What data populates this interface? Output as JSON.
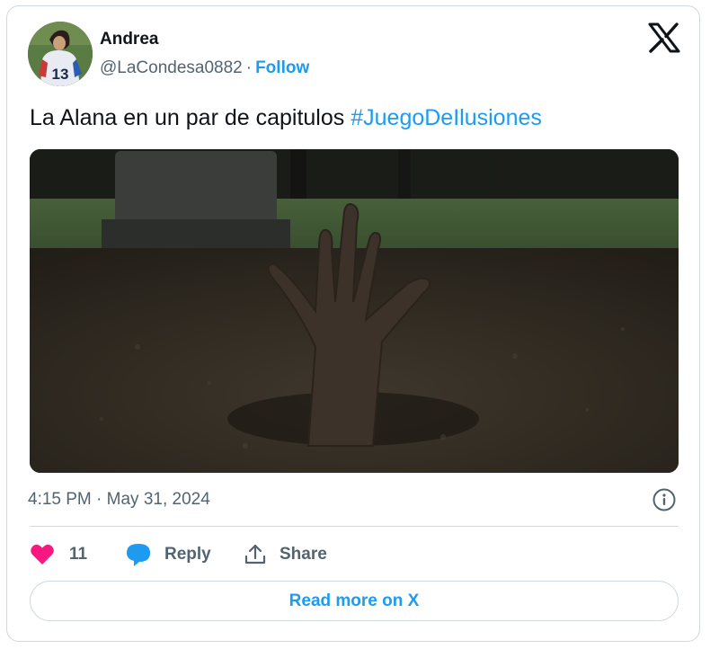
{
  "author": {
    "name": "Andrea",
    "handle": "@LaCondesa0882",
    "separator": "·",
    "follow_label": "Follow",
    "avatar_jersey_number": "13"
  },
  "tweet": {
    "text": "La Alana en un par de capitulos",
    "hashtag": "#JuegoDeIlusiones",
    "media_description": "hand emerging from grave dirt",
    "timestamp": "4:15 PM · May 31, 2024"
  },
  "actions": {
    "like_count": "11",
    "reply_label": "Reply",
    "share_label": "Share"
  },
  "footer": {
    "read_more_label": "Read more on X"
  },
  "icons": {
    "brand": "x-logo-icon",
    "info": "info-icon",
    "like": "heart-icon",
    "reply": "speech-bubble-icon",
    "share": "share-upload-icon"
  },
  "colors": {
    "accent": "#1d9bf0",
    "like": "#f91880",
    "secondary_text": "#536471",
    "border": "#cfd9de"
  }
}
